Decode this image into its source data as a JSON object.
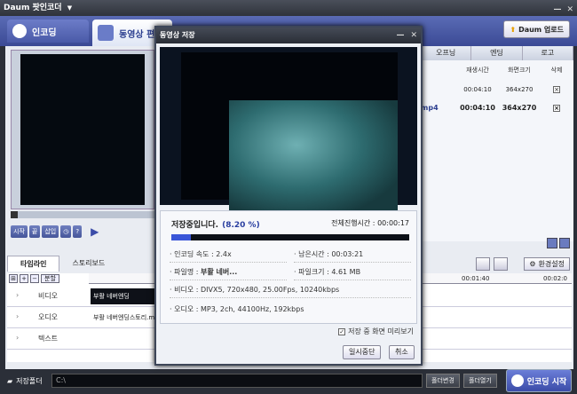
{
  "app": {
    "title": "Daum 팟인코더",
    "title_arrow": "▼",
    "min": "—",
    "close": "✕"
  },
  "topbar": {
    "tab_encoding": "인코딩",
    "tab_edit": "동영상 편",
    "upload": "Daum 업로드"
  },
  "controls": {
    "start": "시작",
    "end": "끝",
    "insert": "삽입",
    "help": "?"
  },
  "right": {
    "tabs": [
      "오프닝",
      "엔딩",
      "로고"
    ],
    "headers": [
      "재생시간",
      "화면크기",
      "삭제"
    ],
    "rows": [
      {
        "name": "",
        "time": "00:04:10",
        "size": "364x270"
      },
      {
        "name": "mp4",
        "time": "00:04:10",
        "size": "364x270"
      }
    ]
  },
  "lower": {
    "tab_timeline": "타임라인",
    "tab_storyboard": "스토리보드",
    "env_settings": "환경설정",
    "split": "분할"
  },
  "timeline": {
    "ruler": [
      "00:01:40",
      "00:02:0"
    ],
    "tracks": [
      "비디오",
      "오디오",
      "텍스트"
    ],
    "video_clip": "부활 네버엔딩",
    "audio_clip": "부활 네버엔딩스토리.m"
  },
  "bottom": {
    "folder_label": "저장폴더",
    "folder_value": "C:\\",
    "btn_change": "폴더변경",
    "btn_open": "폴더열기",
    "start": "인코딩 시작"
  },
  "dialog": {
    "title": "동영상 저장",
    "status": "저장중입니다.",
    "percent": "(8.20 %)",
    "progress": 0.082,
    "total_label": "전체진행시간 :",
    "total_value": "00:00:17",
    "speed_label": "인코딩 속도 :",
    "speed_value": "2.4x",
    "remain_label": "남은시간 :",
    "remain_value": "00:03:21",
    "file_label": "파일명 :",
    "file_value": "부활 네버...",
    "size_label": "파일크기 :",
    "size_value": "4.61 MB",
    "video_label": "비디오 :",
    "video_value": "DIVX5, 720x480, 25.00Fps, 10240kbps",
    "audio_label": "오디오 :",
    "audio_value": "MP3, 2ch, 44100Hz, 192kbps",
    "preview_check": "저장 중 화면 미리보기",
    "pause": "일시중단",
    "cancel": "취소"
  }
}
